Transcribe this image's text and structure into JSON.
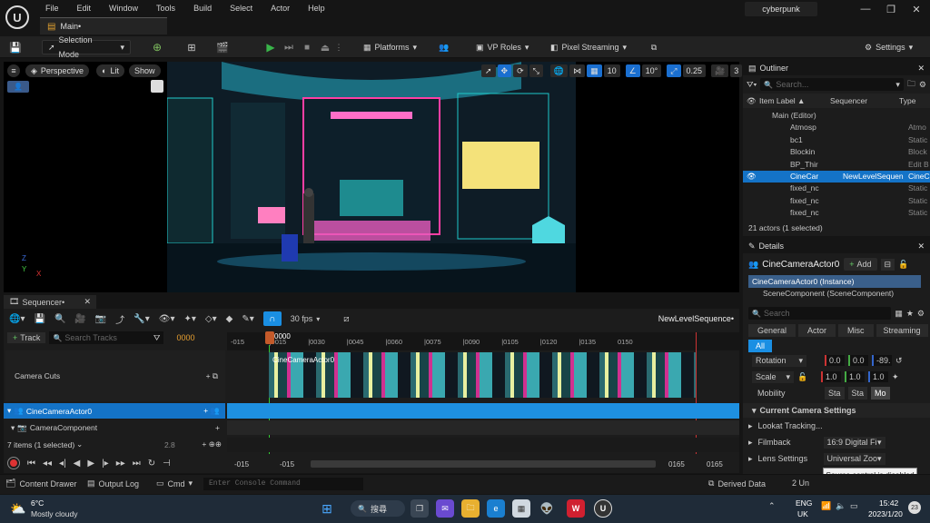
{
  "menu": [
    "File",
    "Edit",
    "Window",
    "Tools",
    "Build",
    "Select",
    "Actor",
    "Help"
  ],
  "project_name": "cyberpunk",
  "tab_label": "Main•",
  "toolbar": {
    "selection_mode": "Selection Mode",
    "platforms": "Platforms",
    "vp_roles": "VP Roles",
    "pixel_streaming": "Pixel Streaming",
    "settings": "Settings"
  },
  "viewport": {
    "perspective": "Perspective",
    "lit": "Lit",
    "show": "Show",
    "grid_snap": "10",
    "rot_snap": "10°",
    "scale_snap": "0.25",
    "cam_speed": "3",
    "axis_z": "Z",
    "axis_y": "Y",
    "axis_x": "X"
  },
  "outliner": {
    "title": "Outliner",
    "search_placeholder": "Search...",
    "col_item": "Item Label ▲",
    "col_seq": "Sequencer",
    "col_type": "Type",
    "rows": [
      {
        "label": "Main (Editor)",
        "seq": "",
        "type": ""
      },
      {
        "label": "Atmosp",
        "seq": "",
        "type": "Atmo"
      },
      {
        "label": "bc1",
        "seq": "",
        "type": "Static"
      },
      {
        "label": "Blockin",
        "seq": "",
        "type": "Block"
      },
      {
        "label": "BP_Thir",
        "seq": "",
        "type": "Edit B"
      },
      {
        "label": "CineCar",
        "seq": "NewLevelSequen",
        "type": "CineC"
      },
      {
        "label": "fixed_nc",
        "seq": "",
        "type": "Static"
      },
      {
        "label": "fixed_nc",
        "seq": "",
        "type": "Static"
      },
      {
        "label": "fixed_nc",
        "seq": "",
        "type": "Static"
      }
    ],
    "status": "21 actors (1 selected)"
  },
  "details": {
    "title": "Details",
    "actor_name": "CineCameraActor0",
    "add_label": "Add",
    "instance": "CineCameraActor0 (Instance)",
    "component": "SceneComponent (SceneComponent)",
    "search_placeholder": "Search",
    "filters": [
      "General",
      "Actor",
      "Misc",
      "Streaming",
      "All"
    ],
    "rotation_label": "Rotation",
    "rotation_values": [
      "0.0",
      "0.0",
      "-89."
    ],
    "scale_label": "Scale",
    "scale_values": [
      "1.0",
      "1.0",
      "1.0"
    ],
    "mobility_label": "Mobility",
    "mobility_options": [
      "Sta",
      "Sta",
      "Mo"
    ],
    "section_camera": "Current Camera Settings",
    "lookat": "Lookat Tracking...",
    "filmback": "Filmback",
    "filmback_value": "16:9 Digital Film",
    "lens": "Lens Settings",
    "lens_value": "Universal Zoom",
    "tooltip": "Source control is disabled"
  },
  "sequencer": {
    "tab": "Sequencer•",
    "fps": "30 fps",
    "sequence_name": "NewLevelSequence•",
    "track_btn": "Track",
    "search_placeholder": "Search Tracks",
    "current_frame": "0000",
    "playhead_label": "0000",
    "ruler": [
      "-015",
      "|0015",
      "|0030",
      "|0045",
      "|0060",
      "|0075",
      "|0090",
      "|0105",
      "|0120",
      "|0135",
      "0150"
    ],
    "tracks": [
      "Camera Cuts",
      "CineCameraActor0",
      "CameraComponent"
    ],
    "items_status": "7 items (1 selected)",
    "bottom_frame": "2.8",
    "range_start": "-015",
    "range_start2": "-015",
    "range_end": "0165",
    "range_end2": "0165",
    "camera_cut_label": "CineCameraActor0"
  },
  "bottombar": {
    "content_drawer": "Content Drawer",
    "output_log": "Output Log",
    "cmd": "Cmd",
    "console_placeholder": "Enter Console Command",
    "derived_data": "Derived Data",
    "unsaved": "2 Un"
  },
  "taskbar": {
    "weather_temp": "6°C",
    "weather_desc": "Mostly cloudy",
    "search": "搜尋",
    "lang1": "ENG",
    "lang2": "UK",
    "time": "15:42",
    "date": "2023/1/20",
    "notif": "23"
  },
  "colors": {
    "accent": "#1a8fe3",
    "selected_row": "#1473c7",
    "track_blue": "#1e90e0",
    "play_green": "#39b54a"
  }
}
